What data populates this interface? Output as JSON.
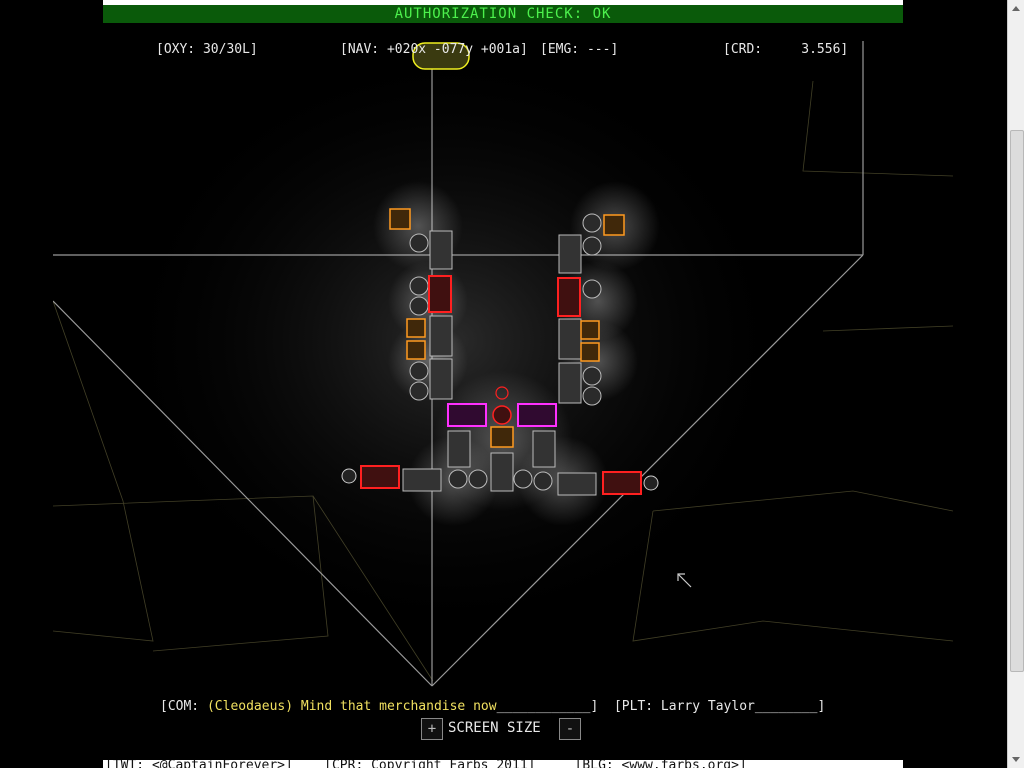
{
  "header": {
    "auth_text": "AUTHORIZATION CHECK: OK"
  },
  "hud": {
    "oxy": "[OXY: 30/30L]",
    "nav": "[NAV: +020x -077y +001a]",
    "emg": "[EMG: ---]",
    "crd": "[CRD:     3.556]"
  },
  "comms": {
    "prefix": "[COM: ",
    "speaker": "(Cleodaeus)",
    "message": " Mind that merchandise now",
    "suffix": "____________]",
    "pilot": "  [PLT: Larry Taylor________]"
  },
  "controls": {
    "plus": "+",
    "screen_size": "SCREEN SIZE",
    "minus": "-"
  },
  "footer": {
    "text": "[TWT: <@CaptainForever>]    [CPR: Copyright Farbs 2011]     [BLG: <www.farbs.org>]"
  },
  "colors": {
    "auth_bg": "#0a5a0a",
    "auth_text": "#4cf04c",
    "hull_red": "#ff2020",
    "thruster_orange": "#ff9a20",
    "core_magenta": "#ff30ff",
    "hud_yellow": "#f0e060"
  }
}
